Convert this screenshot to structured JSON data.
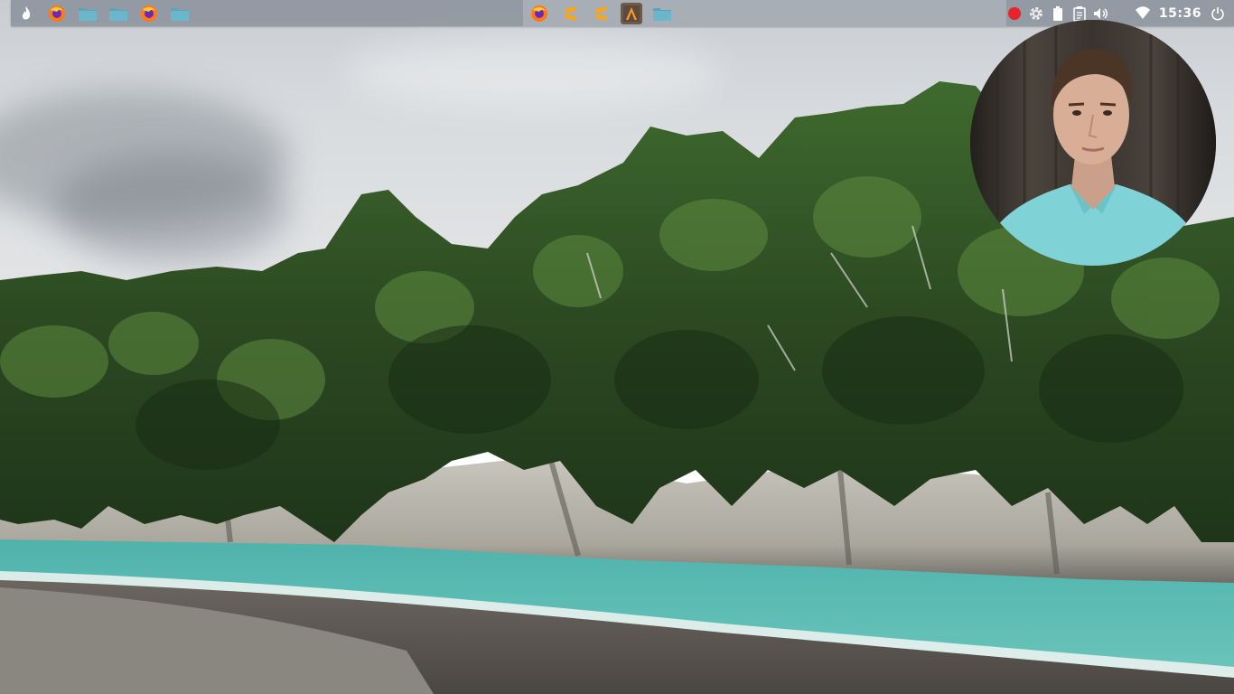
{
  "panel": {
    "launchers_left": [
      {
        "icon": "flame-app-icon"
      },
      {
        "icon": "firefox-icon"
      },
      {
        "icon": "folder-icon"
      },
      {
        "icon": "folder-icon"
      },
      {
        "icon": "firefox-icon"
      },
      {
        "icon": "folder-icon"
      }
    ],
    "tasks_center": [
      {
        "icon": "firefox-icon"
      },
      {
        "icon": "sublime-text-icon"
      },
      {
        "icon": "sublime-text-icon"
      },
      {
        "icon": "vector-app-icon"
      },
      {
        "icon": "folder-icon"
      }
    ],
    "tray": {
      "recording_color": "#e8232b",
      "clock": "15:36"
    }
  },
  "colors": {
    "panel": "#8e969e",
    "folder": "#5aa3b9",
    "accent_sublime": "#f5a623"
  }
}
